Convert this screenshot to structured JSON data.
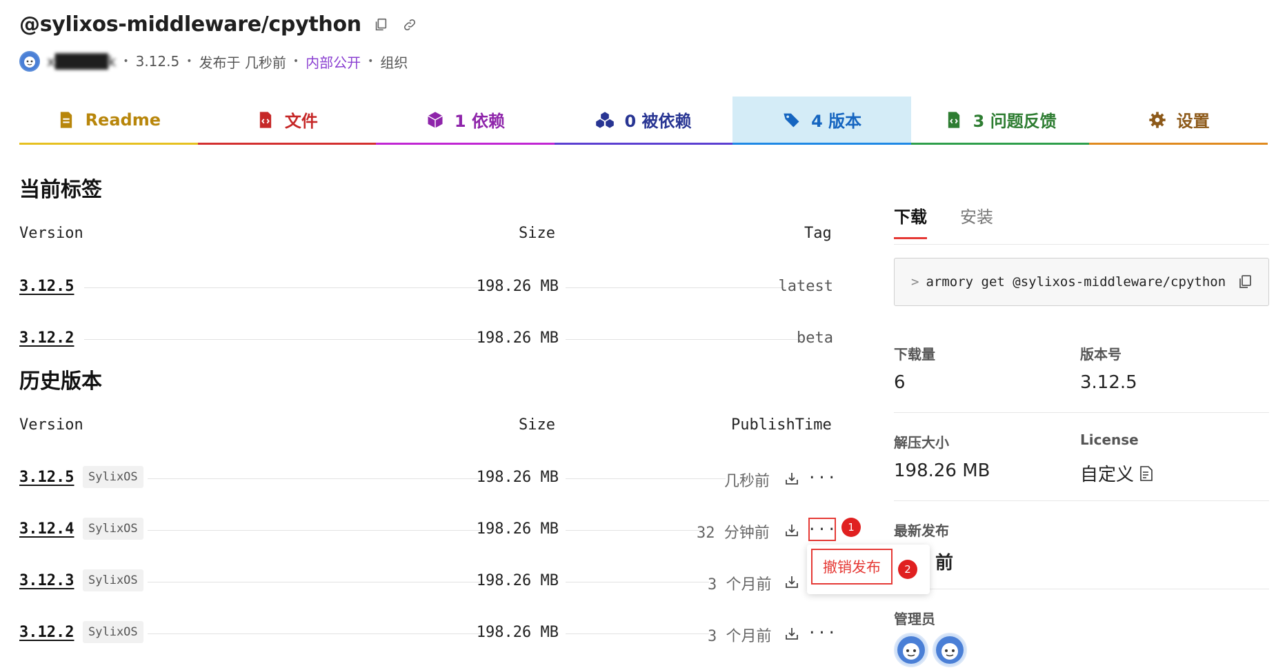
{
  "header": {
    "title": "@sylixos-middleware/cpython",
    "username": "x█████k",
    "version": "3.12.5",
    "published": "发布于 几秒前",
    "visibility": "内部公开",
    "owner_type": "组织"
  },
  "tabs": [
    {
      "label": "Readme",
      "color": "#b8860b",
      "underline": "#e6c020"
    },
    {
      "label": "文件",
      "color": "#c62828",
      "underline": "#d32f2f"
    },
    {
      "label": "1 依赖",
      "color": "#8e24aa",
      "underline": "#c026d3"
    },
    {
      "label": "0 被依赖",
      "color": "#283593",
      "underline": "#5b3fd1"
    },
    {
      "label": "4 版本",
      "color": "#1565c0",
      "underline": "#1e88e5"
    },
    {
      "label": "3 问题反馈",
      "color": "#2e7d32",
      "underline": "#2e9e4a"
    },
    {
      "label": "设置",
      "color": "#8d5a1a",
      "underline": "#e08a1e"
    }
  ],
  "current_tags": {
    "heading": "当前标签",
    "columns": {
      "version": "Version",
      "size": "Size",
      "tag": "Tag"
    },
    "rows": [
      {
        "version": "3.12.5",
        "size": "198.26 MB",
        "tag": "latest"
      },
      {
        "version": "3.12.2",
        "size": "198.26 MB",
        "tag": "beta"
      }
    ]
  },
  "history": {
    "heading": "历史版本",
    "columns": {
      "version": "Version",
      "size": "Size",
      "time": "PublishTime"
    },
    "rows": [
      {
        "version": "3.12.5",
        "os": "SylixOS",
        "size": "198.26 MB",
        "time": "几秒前"
      },
      {
        "version": "3.12.4",
        "os": "SylixOS",
        "size": "198.26 MB",
        "time": "32 分钟前"
      },
      {
        "version": "3.12.3",
        "os": "SylixOS",
        "size": "198.26 MB",
        "time": "3 个月前"
      },
      {
        "version": "3.12.2",
        "os": "SylixOS",
        "size": "198.26 MB",
        "time": "3 个月前"
      }
    ],
    "more_label": "···"
  },
  "dropdown": {
    "unpublish": "撤销发布"
  },
  "steps": {
    "one": "1",
    "two": "2"
  },
  "sidebar": {
    "tab_download": "下载",
    "tab_install": "安装",
    "prompt": ">",
    "command": "armory get @sylixos-middleware/cpython",
    "stats": {
      "downloads_label": "下载量",
      "downloads_value": "6",
      "version_label": "版本号",
      "version_value": "3.12.5",
      "unpacked_label": "解压大小",
      "unpacked_value": "198.26 MB",
      "license_label": "License",
      "license_value": "自定义",
      "latest_label": "最新发布",
      "latest_value_visible": "前",
      "admins_label": "管理员"
    }
  }
}
